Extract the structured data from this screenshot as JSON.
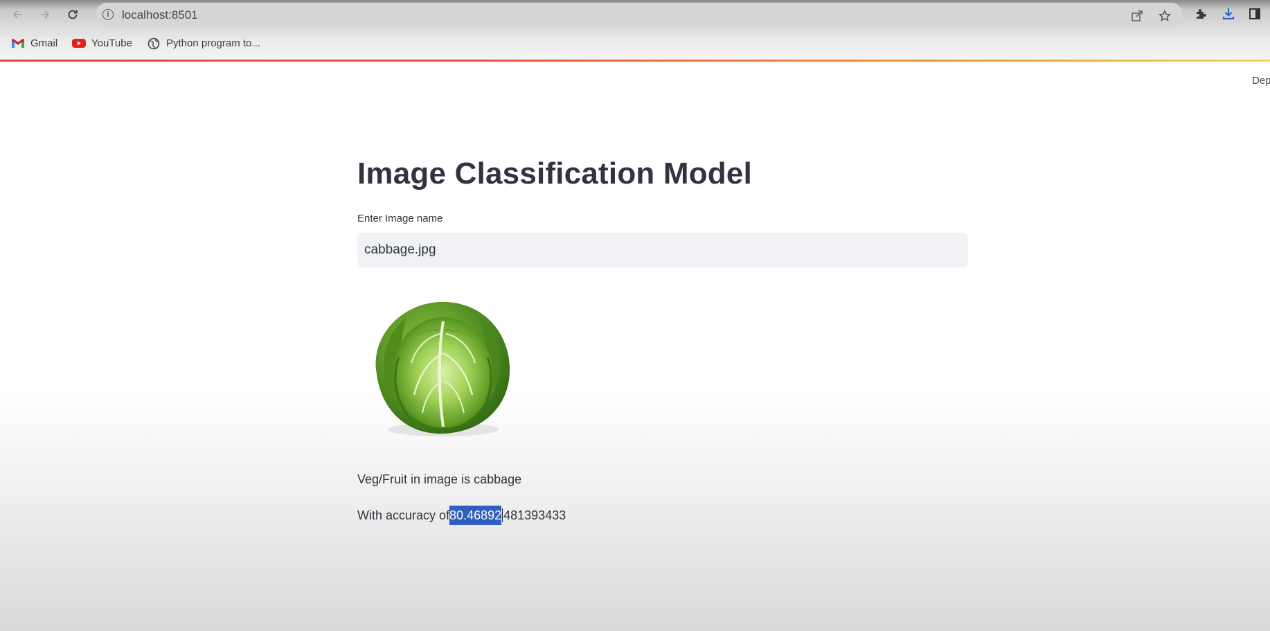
{
  "browser": {
    "url": "localhost:8501",
    "bookmarks": [
      {
        "label": "Gmail",
        "icon": "gmail-icon"
      },
      {
        "label": "YouTube",
        "icon": "youtube-icon"
      },
      {
        "label": "Python program to...",
        "icon": "globe-icon"
      }
    ],
    "loading_bar_colors": [
      "#e0463c",
      "#f2a23a",
      "#f5d35c"
    ]
  },
  "app": {
    "deploy_label": "Dep",
    "title": "Image Classification Model",
    "input": {
      "label": "Enter Image name",
      "value": "cabbage.jpg"
    },
    "image": {
      "subject": "cabbage",
      "icon": "cabbage-image"
    },
    "result": {
      "prediction_prefix": "Veg/Fruit in image is",
      "prediction_value": "cabbage",
      "accuracy_prefix": "With accuracy of",
      "accuracy_selected": "80.46892",
      "accuracy_rest": "481393433"
    },
    "colors": {
      "text": "#31333f",
      "input_bg": "#f0f2f6",
      "selection": "#2f5fbf"
    }
  }
}
